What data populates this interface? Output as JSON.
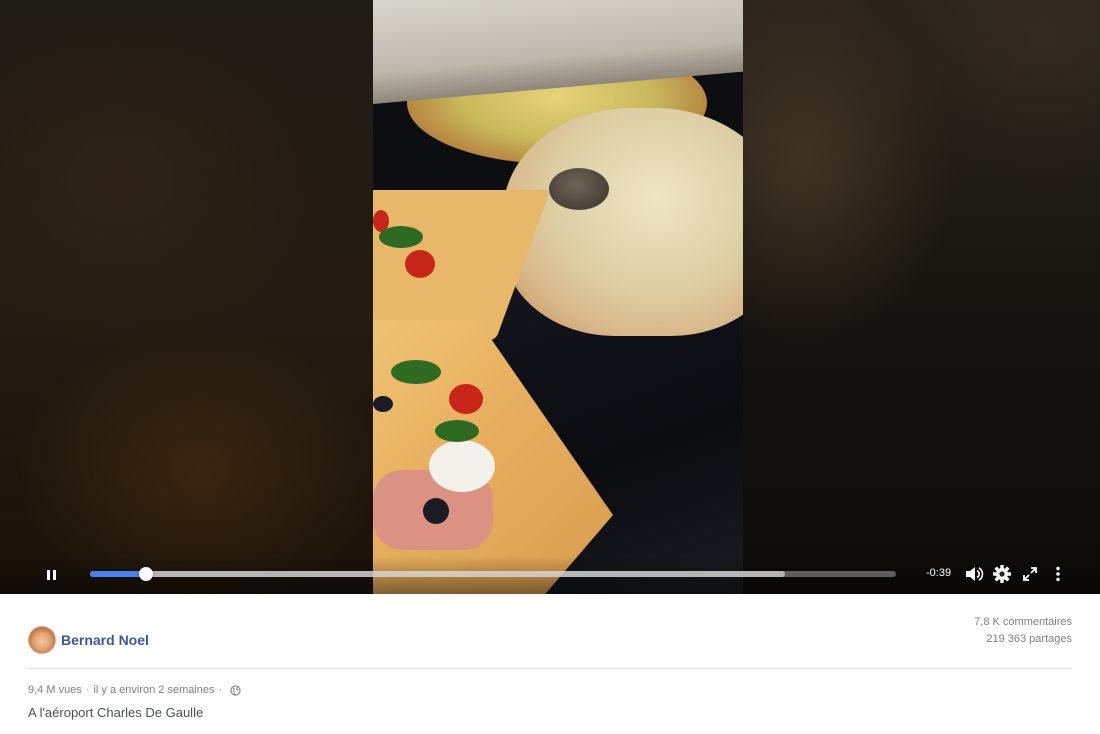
{
  "video": {
    "time_remaining": "-0:39",
    "progress_played": 0.069,
    "progress_buffered": 0.862,
    "controls": {
      "play_pause": "pause-icon",
      "volume": "volume-icon",
      "settings": "gear-icon",
      "fullscreen": "expand-icon",
      "more": "more-vertical-icon"
    },
    "accent_color": "#4a7ff0"
  },
  "post": {
    "author": "Bernard Noel",
    "comments": "7,8 K commentaires",
    "shares": "219 363 partages",
    "views": "9,4 M vues",
    "timestamp": "il y a environ 2 semaines",
    "separator": "·",
    "privacy_icon": "globe-icon",
    "caption": "A l'aéroport Charles De Gaulle",
    "author_color": "#385898"
  }
}
